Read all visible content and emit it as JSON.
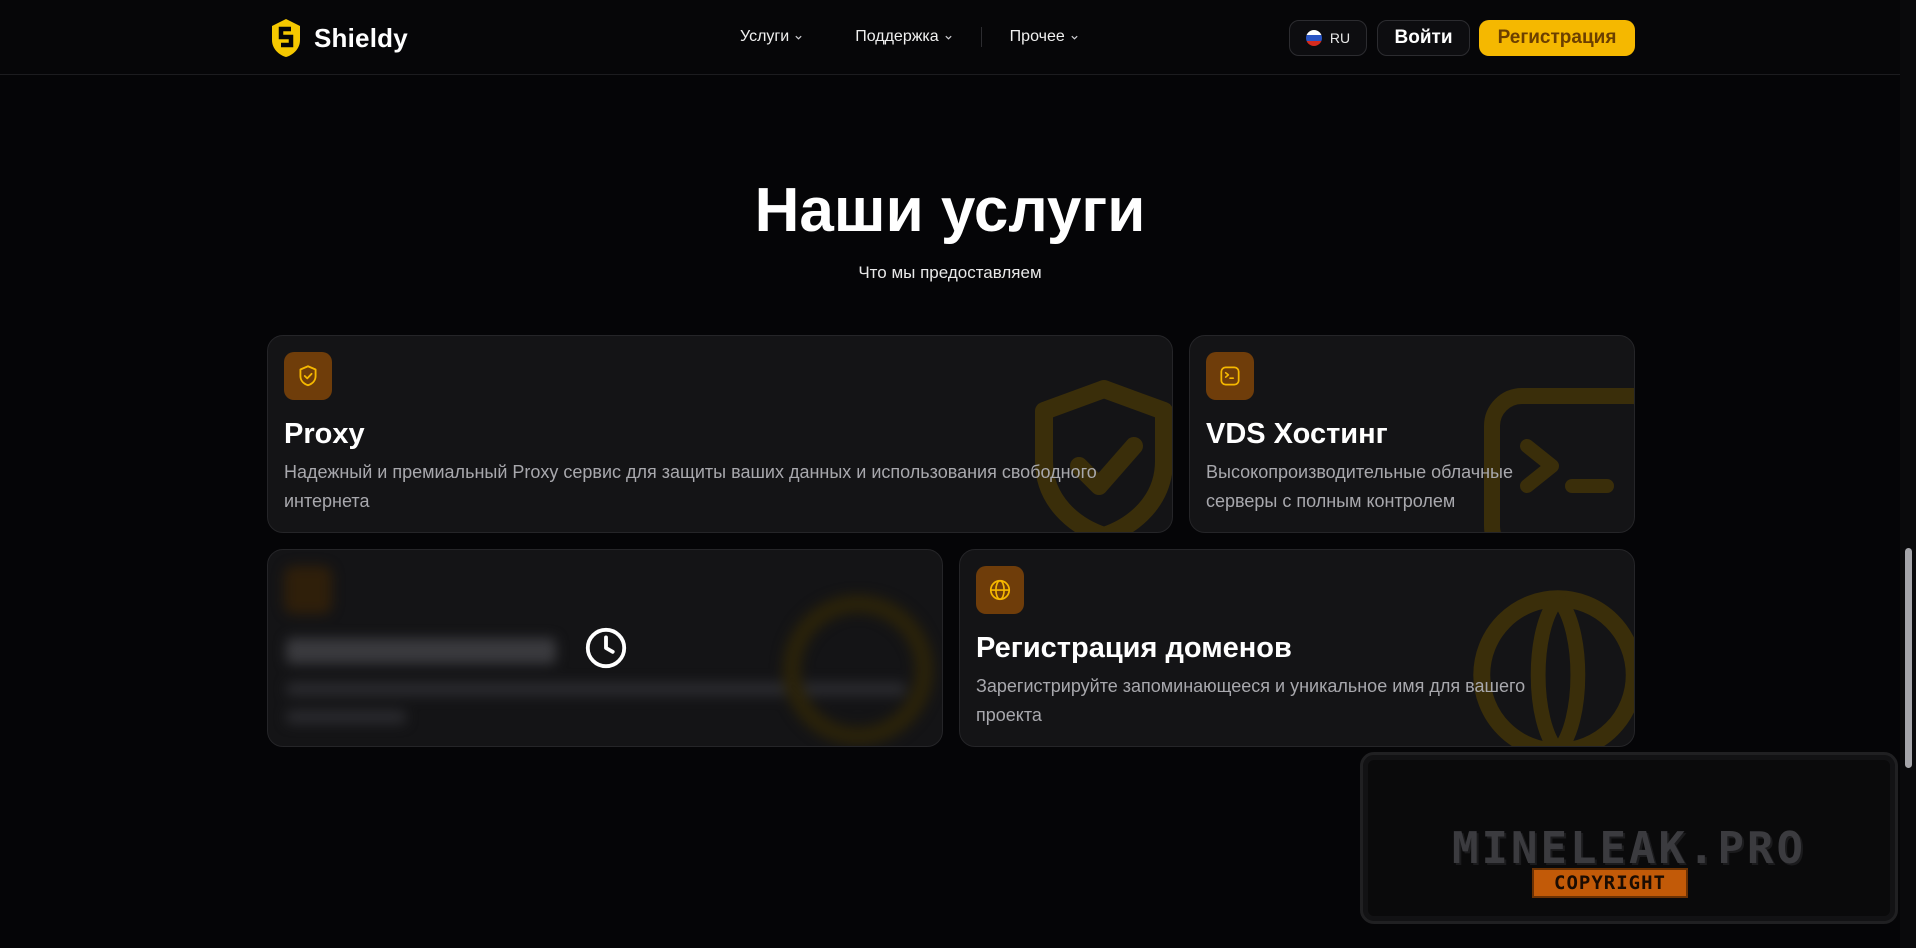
{
  "header": {
    "logo_text": "Shieldy",
    "nav": [
      {
        "label": "Услуги"
      },
      {
        "label": "Поддержка"
      },
      {
        "label": "Прочее"
      }
    ],
    "lang_label": "RU",
    "login_label": "Войти",
    "register_label": "Регистрация"
  },
  "hero": {
    "title": "Наши услуги",
    "subtitle": "Что мы предоставляем"
  },
  "services": [
    {
      "title": "Proxy",
      "description": "Надежный и премиальный Proxy сервис для защиты ваших данных и использования свободного интернета",
      "icon": "shield-check-icon",
      "locked": false
    },
    {
      "title": "VDS Хостинг",
      "description": "Высокопроизводительные облачные серверы с полным контролем",
      "icon": "terminal-icon",
      "locked": false
    },
    {
      "title": "",
      "description": "",
      "icon": "clock-icon",
      "locked": true
    },
    {
      "title": "Регистрация доменов",
      "description": "Зарегистрируйте запоминающееся и уникальное имя для вашего проекта",
      "icon": "globe-icon",
      "locked": false
    }
  ],
  "watermark": {
    "text": "MINELEAK.PRO",
    "badge": "COPYRIGHT"
  },
  "colors": {
    "accent": "#f5b800",
    "icon_bg": "#6f3d0a",
    "card_bg": "#141416",
    "page_bg": "#050507"
  }
}
